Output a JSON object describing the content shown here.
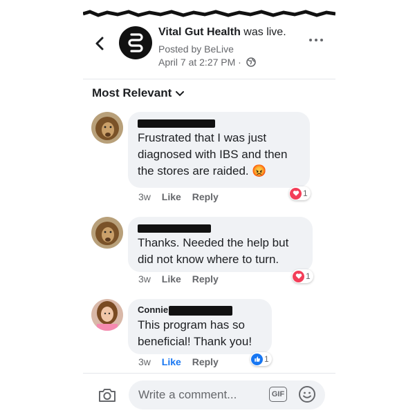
{
  "post": {
    "page_name": "Vital Gut Health",
    "action_text": "was live.",
    "posted_by": "Posted by BeLive",
    "timestamp": "April 7 at 2:27 PM",
    "separator": "·"
  },
  "sort": {
    "label": "Most Relevant"
  },
  "comments": [
    {
      "text": "Frustrated that I was just\ndiagnosed with IBS and then\nthe stores are raided.",
      "emoji": "😡",
      "age": "3w",
      "like": "Like",
      "reply": "Reply",
      "reaction": "heart",
      "reaction_count": "1"
    },
    {
      "text": "Thanks. Needed the help but\ndid not know where to turn.",
      "age": "3w",
      "like": "Like",
      "reply": "Reply",
      "reaction": "heart",
      "reaction_count": "1"
    },
    {
      "author": "Connie",
      "text": " This program has so\nbeneficial! Thank you!",
      "age": "3w",
      "like": "Like",
      "reply": "Reply",
      "liked": true,
      "reaction": "thumbs-up",
      "reaction_count": "1"
    }
  ],
  "composer": {
    "placeholder": "Write a comment...",
    "gif_label": "GIF"
  },
  "colors": {
    "heart": "#f33e58",
    "like_blue": "#1877f2",
    "bubble": "#f0f2f5",
    "muted": "#65676b"
  },
  "icons": [
    "back-arrow-icon",
    "page-logo-icon",
    "globe-icon",
    "more-icon",
    "chevron-down-icon",
    "camera-icon",
    "gif-icon",
    "smiley-icon",
    "heart-reaction-icon",
    "like-reaction-icon"
  ]
}
